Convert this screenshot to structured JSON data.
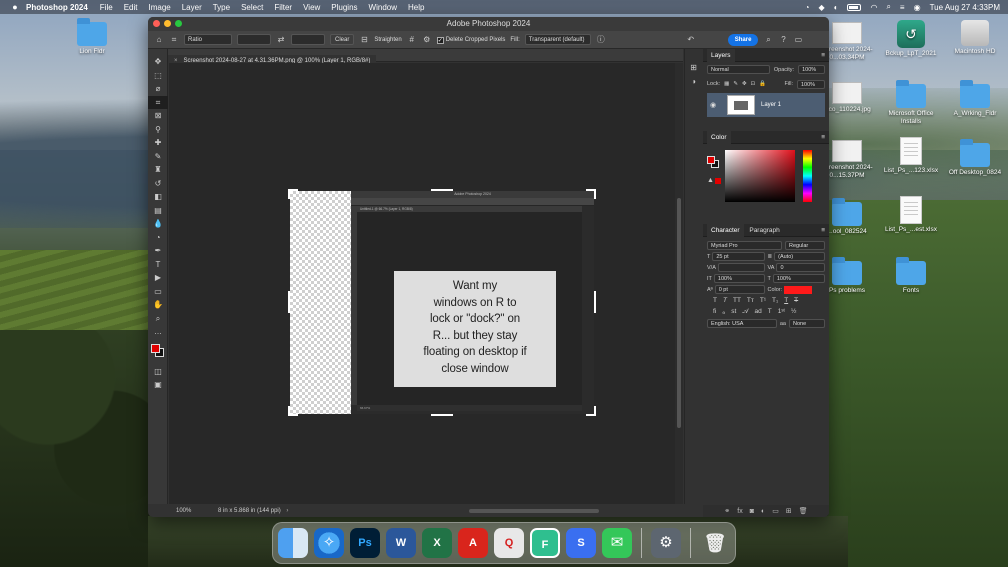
{
  "menubar": {
    "apple": "",
    "app_name": "Photoshop 2024",
    "items": [
      "File",
      "Edit",
      "Image",
      "Layer",
      "Type",
      "Select",
      "Filter",
      "View",
      "Plugins",
      "Window",
      "Help"
    ],
    "clock": "Tue Aug 27  4:33PM"
  },
  "desktop": {
    "icons": [
      {
        "name": "Lion Fldr",
        "kind": "folder"
      },
      {
        "name": "Screenshot 2024-0...03.34PM",
        "kind": "thumb"
      },
      {
        "name": "Bckup_LpT_2021",
        "kind": "timemachine"
      },
      {
        "name": "Macintosh HD",
        "kind": "drive"
      },
      {
        "name": "...co_110224.jpg",
        "kind": "thumb"
      },
      {
        "name": "Microsoft Office Installs",
        "kind": "folder"
      },
      {
        "name": "A_Wrking_Fldr",
        "kind": "folder"
      },
      {
        "name": "Screenshot 2024-0...15.37PM",
        "kind": "thumb"
      },
      {
        "name": "List_Ps_...123.xlsx",
        "kind": "doc"
      },
      {
        "name": "Off Desktop_0824",
        "kind": "folder"
      },
      {
        "name": "...ool_082524",
        "kind": "folder"
      },
      {
        "name": "List_Ps_...est.xlsx",
        "kind": "doc"
      },
      {
        "name": "Ps problems",
        "kind": "folder"
      },
      {
        "name": "Fonts",
        "kind": "folder"
      }
    ]
  },
  "ps": {
    "window_title": "Adobe Photoshop 2024",
    "options": {
      "ratio": "Ratio",
      "clear": "Clear",
      "straighten": "Straighten",
      "delete_cropped": "Delete Cropped Pixels",
      "fill_label": "Fill:",
      "fill_value": "Transparent (default)",
      "share": "Share"
    },
    "doc_tab": "Screenshot 2024-08-27 at 4.31.36PM.png @ 100% (Layer 1, RGB/8#)",
    "status": {
      "zoom": "100%",
      "info": "8 in x 5.868 in (144 ppi)"
    },
    "inner": {
      "title": "Adobe Photoshop 2024",
      "tab": "Untitled-1 @ 66.7% (Layer 1, RGB/8)",
      "status": "66.67%"
    },
    "note_lines": [
      "Want my",
      "windows on R to",
      "lock or \"dock?\" on",
      "R... but they stay",
      "floating on desktop if",
      "close window"
    ],
    "layers": {
      "title": "Layers",
      "blend": "Normal",
      "opacity_label": "Opacity:",
      "opacity": "100%",
      "lock_label": "Lock:",
      "fill_label": "Fill:",
      "fill": "100%",
      "layer_name": "Layer 1"
    },
    "color": {
      "title": "Color",
      "fg": "#e10000",
      "bg": "#111111"
    },
    "character": {
      "tab1": "Character",
      "tab2": "Paragraph",
      "font": "Myriad Pro",
      "style": "Regular",
      "size": "25 pt",
      "leading": "(Auto)",
      "kerning": "",
      "tracking": "0",
      "vscale": "100%",
      "hscale": "100%",
      "baseline": "0 pt",
      "color_label": "Color:",
      "language": "English: USA",
      "aa": "None"
    }
  },
  "colors": {
    "accent": "#1473e6",
    "layer_selected": "#4c5d72",
    "text_color": "#ff1a1a"
  }
}
